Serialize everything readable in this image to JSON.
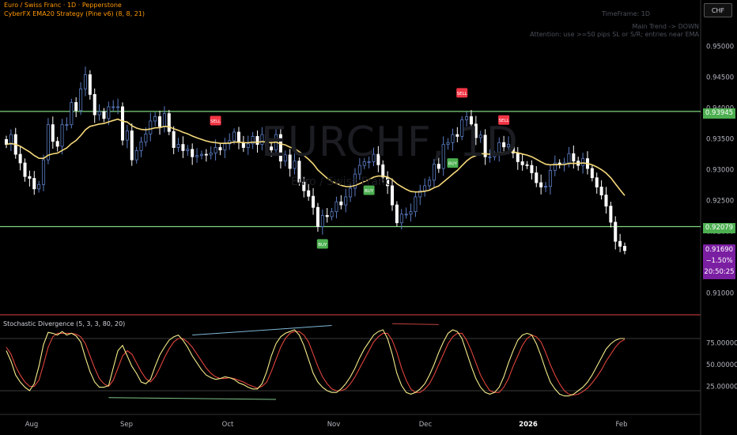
{
  "header": {
    "symbol_line": "Euro / Swiss Franc · 1D · Pepperstone",
    "study_line": "CyberFX EMA20 Strategy (Pine v6) (8, 8, 21)",
    "currency_button": "CHF",
    "watermark_symbol": "EURCHF, 1D",
    "watermark_name": "Euro / Swiss Franc"
  },
  "info_panel": {
    "timeframe": "TimeFrame: 1D",
    "trend": "Main Trend -> DOWN",
    "note": "Attention: use >=50 pips SL or S/R; entries near EMA"
  },
  "last_price": {
    "price": "0.91690",
    "change": "−1.50%",
    "countdown": "20:50:25"
  },
  "price_axis_labels": [
    "0.95000",
    "0.94500",
    "0.94000",
    "0.93500",
    "0.93000",
    "0.92500",
    "0.92000",
    "0.91500",
    "0.91000"
  ],
  "osc_axis_labels": [
    "75.00000",
    "50.00000",
    "25.00000"
  ],
  "time_axis_labels": [
    "Aug",
    "Sep",
    "Oct",
    "Nov",
    "Dec",
    "2026",
    "Feb"
  ],
  "oscillator_title": "Stochastic Divergence (5, 3, 3, 80, 20)",
  "colors": {
    "up_candle": "#5b7cc4",
    "down_candle": "#ffffff",
    "ema": "#f5d97a",
    "level": "#7ed67e",
    "buy": "#4caf50",
    "sell": "#f23645",
    "stoch_k": "#f5ec8a",
    "stoch_d": "#e0443c",
    "last": "#7b1fa2"
  },
  "chart_data": {
    "type": "candlestick",
    "ylim": [
      0.9065,
      0.9575
    ],
    "resistance_level": 0.93945,
    "support_level": 0.92079,
    "level_labels": [
      "0.93945",
      "0.92079"
    ],
    "signal_labels": {
      "buy": "BUY",
      "sell": "SELL"
    },
    "closes": [
      0.9341,
      0.9357,
      0.9325,
      0.9311,
      0.9289,
      0.9286,
      0.9269,
      0.9276,
      0.9316,
      0.9373,
      0.9346,
      0.9338,
      0.9373,
      0.9373,
      0.9409,
      0.9396,
      0.9431,
      0.9454,
      0.9422,
      0.9389,
      0.9394,
      0.9383,
      0.9402,
      0.9402,
      0.9402,
      0.9348,
      0.9363,
      0.9316,
      0.9331,
      0.9345,
      0.9358,
      0.9379,
      0.9386,
      0.937,
      0.9391,
      0.9362,
      0.9336,
      0.9341,
      0.9331,
      0.9333,
      0.9321,
      0.9323,
      0.9325,
      0.9324,
      0.9327,
      0.9336,
      0.9332,
      0.9342,
      0.9347,
      0.9361,
      0.9344,
      0.9336,
      0.9342,
      0.9354,
      0.9341,
      0.9357,
      0.9337,
      0.9332,
      0.9357,
      0.9314,
      0.9324,
      0.9302,
      0.9314,
      0.928,
      0.9266,
      0.9257,
      0.9239,
      0.9208,
      0.9226,
      0.9224,
      0.9232,
      0.9248,
      0.9243,
      0.9256,
      0.927,
      0.9293,
      0.9307,
      0.9313,
      0.9313,
      0.9325,
      0.9308,
      0.9288,
      0.9274,
      0.9243,
      0.9214,
      0.9228,
      0.9228,
      0.9232,
      0.9256,
      0.9266,
      0.9274,
      0.9283,
      0.9309,
      0.9302,
      0.9341,
      0.9344,
      0.9357,
      0.9354,
      0.9381,
      0.9386,
      0.9374,
      0.9352,
      0.9356,
      0.9321,
      0.9321,
      0.9324,
      0.9344,
      0.9337,
      0.9341,
      0.9327,
      0.9313,
      0.9308,
      0.9307,
      0.9295,
      0.9279,
      0.9272,
      0.9273,
      0.9299,
      0.9311,
      0.9308,
      0.9311,
      0.9326,
      0.9314,
      0.9307,
      0.9318,
      0.9302,
      0.9287,
      0.9272,
      0.9259,
      0.9241,
      0.9215,
      0.9184,
      0.9176,
      0.9169
    ],
    "stoch_k": [
      66,
      54,
      38,
      30,
      24,
      20,
      28,
      48,
      73,
      87,
      86,
      84,
      88,
      84,
      86,
      83,
      76,
      58,
      42,
      30,
      24,
      24,
      26,
      46,
      66,
      72,
      60,
      48,
      40,
      30,
      28,
      33,
      48,
      61,
      70,
      78,
      82,
      84,
      78,
      70,
      60,
      52,
      44,
      38,
      35,
      33,
      34,
      36,
      35,
      33,
      29,
      27,
      24,
      22,
      22,
      28,
      42,
      60,
      74,
      82,
      86,
      88,
      90,
      84,
      72,
      56,
      40,
      30,
      24,
      20,
      18,
      18,
      22,
      28,
      36,
      46,
      58,
      68,
      76,
      84,
      88,
      90,
      80,
      62,
      40,
      26,
      18,
      16,
      18,
      22,
      28,
      38,
      50,
      64,
      76,
      86,
      90,
      88,
      80,
      64,
      48,
      34,
      24,
      18,
      16,
      18,
      24,
      36,
      52,
      66,
      78,
      84,
      86,
      84,
      74,
      60,
      44,
      30,
      22,
      16,
      14,
      14,
      16,
      20,
      24,
      30,
      38,
      48,
      58,
      68,
      74,
      78,
      80,
      80
    ],
    "stoch_d": [
      70,
      62,
      48,
      38,
      30,
      25,
      25,
      32,
      50,
      70,
      82,
      86,
      86,
      86,
      86,
      85,
      82,
      74,
      60,
      46,
      34,
      28,
      25,
      32,
      46,
      60,
      66,
      62,
      52,
      42,
      34,
      30,
      36,
      46,
      58,
      68,
      76,
      80,
      80,
      76,
      70,
      62,
      54,
      46,
      40,
      36,
      34,
      34,
      35,
      34,
      32,
      30,
      27,
      25,
      23,
      25,
      30,
      42,
      56,
      70,
      80,
      86,
      88,
      88,
      84,
      76,
      62,
      48,
      36,
      28,
      22,
      20,
      20,
      22,
      28,
      36,
      46,
      56,
      66,
      76,
      82,
      86,
      86,
      78,
      64,
      46,
      32,
      22,
      18,
      18,
      22,
      28,
      38,
      50,
      62,
      74,
      82,
      86,
      86,
      78,
      66,
      52,
      38,
      28,
      20,
      18,
      18,
      24,
      34,
      48,
      60,
      72,
      80,
      84,
      82,
      76,
      64,
      50,
      38,
      28,
      20,
      16,
      15,
      16,
      19,
      23,
      29,
      36,
      44,
      54,
      62,
      70,
      76,
      79
    ]
  }
}
